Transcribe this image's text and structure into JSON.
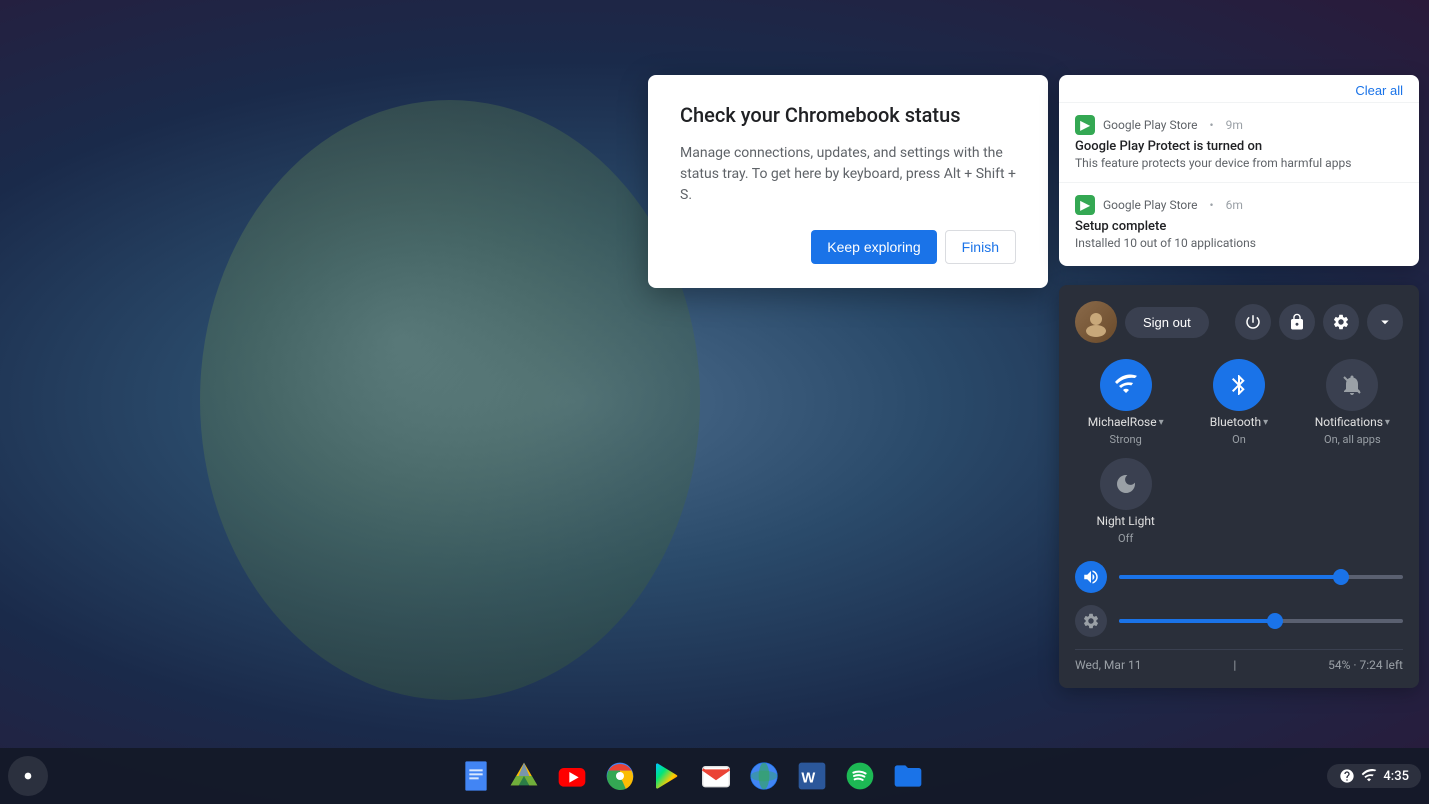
{
  "desktop": {
    "background": "gradient"
  },
  "status_dialog": {
    "title": "Check your Chromebook status",
    "body": "Manage connections, updates, and settings with the status tray. To get here by keyboard, press Alt + Shift + S.",
    "btn_keep_exploring": "Keep exploring",
    "btn_finish": "Finish"
  },
  "notification_panel": {
    "clear_all_label": "Clear all",
    "notifications": [
      {
        "source": "Google Play Store",
        "time": "9m",
        "title": "Google Play Protect is turned on",
        "body": "This feature protects your device from harmful apps"
      },
      {
        "source": "Google Play Store",
        "time": "6m",
        "title": "Setup complete",
        "body": "Installed 10 out of 10 applications"
      }
    ]
  },
  "quick_settings": {
    "sign_out_label": "Sign out",
    "tiles": [
      {
        "id": "wifi",
        "label": "MichaelRose",
        "sublabel": "Strong",
        "active": true,
        "has_arrow": true
      },
      {
        "id": "bluetooth",
        "label": "Bluetooth",
        "sublabel": "On",
        "active": true,
        "has_arrow": true
      },
      {
        "id": "notifications",
        "label": "Notifications",
        "sublabel": "On, all apps",
        "active": false,
        "has_arrow": true
      },
      {
        "id": "nightlight",
        "label": "Night Light",
        "sublabel": "Off",
        "active": false,
        "has_arrow": false
      }
    ],
    "volume_percent": 78,
    "brightness_percent": 55,
    "footer": {
      "date": "Wed, Mar 11",
      "battery": "54% · 7:24 left"
    }
  },
  "taskbar": {
    "time": "4:35",
    "apps": [
      {
        "id": "docs",
        "label": "Google Docs"
      },
      {
        "id": "drive",
        "label": "Google Drive"
      },
      {
        "id": "youtube",
        "label": "YouTube"
      },
      {
        "id": "chrome",
        "label": "Google Chrome"
      },
      {
        "id": "play",
        "label": "Google Play Store"
      },
      {
        "id": "gmail",
        "label": "Gmail"
      },
      {
        "id": "earth",
        "label": "Google Earth"
      },
      {
        "id": "word",
        "label": "Microsoft Word"
      },
      {
        "id": "spotify",
        "label": "Spotify"
      },
      {
        "id": "files",
        "label": "Files"
      }
    ]
  }
}
